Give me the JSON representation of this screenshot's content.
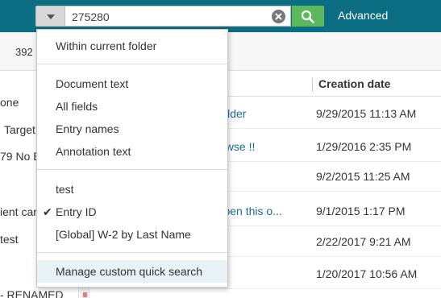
{
  "search": {
    "value": "275280",
    "advanced_label": "Advanced"
  },
  "toolbar": {
    "count": "392"
  },
  "left_items": [
    "one",
    "Target",
    "79 No B",
    "ient car",
    "test",
    "- RENAMED"
  ],
  "table": {
    "columns": {
      "creation_date": "Creation date"
    },
    "rows": [
      {
        "name": "t Folder",
        "date": "9/29/2015 11:13 AM"
      },
      {
        "name": "Browse !!",
        "date": "1/29/2016 2:35 PM"
      },
      {
        "name": "",
        "date": "9/2/2015 11:25 AM"
      },
      {
        "name": "n open this o...",
        "date": "9/1/2015 1:17 PM"
      },
      {
        "name": "",
        "date": "2/22/2017 9:21 AM"
      },
      {
        "name": "",
        "date": "1/20/2017 10:56 AM"
      }
    ]
  },
  "menu": {
    "within_folder": "Within current folder",
    "group1": [
      "Document text",
      "All fields",
      "Entry names",
      "Annotation text"
    ],
    "group2": [
      "test",
      "Entry ID",
      "[Global]  W-2 by Last Name"
    ],
    "checked_index": 1,
    "manage": "Manage custom quick search"
  },
  "colors": {
    "topbar": "#0c6e82",
    "search_button": "#5cb85c",
    "link": "#1a6d96",
    "menu_highlight": "#e8f1f5"
  }
}
